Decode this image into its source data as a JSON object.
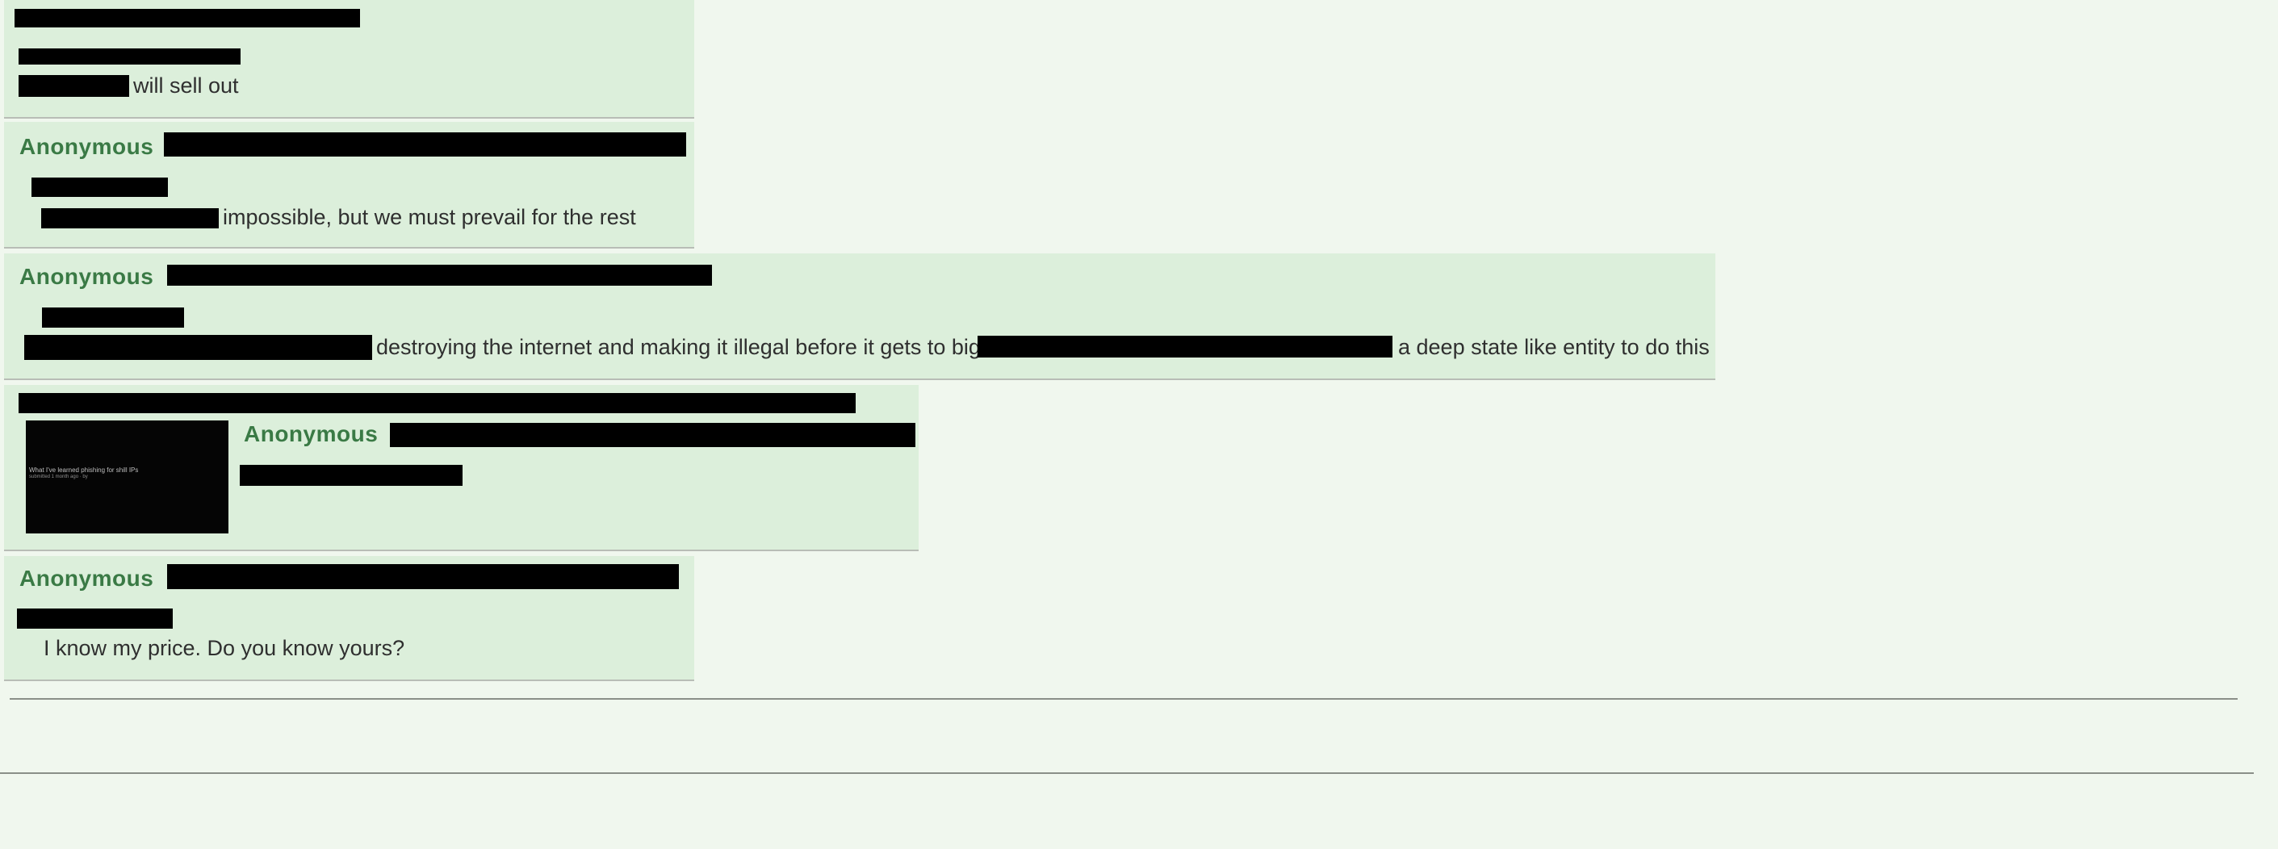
{
  "posts": [
    {
      "tail_text": "will sell out"
    },
    {
      "name": "Anonymous",
      "tail_text": "impossible, but we must prevail for the rest"
    },
    {
      "name": "Anonymous",
      "mid_text": "destroying the internet and making it illegal before it gets to big?",
      "tail_text": "a deep state like entity to do this"
    },
    {
      "name": "Anonymous",
      "thumb_caption": "What I've learned phishing for shill IPs",
      "thumb_sub": "submitted 1 month ago · by"
    },
    {
      "name": "Anonymous",
      "text": "I know my price. Do you know yours?"
    }
  ],
  "colors": {
    "page_bg": "#f0f7ee",
    "post_bg": "#dcefdb",
    "name_green": "#3a7a45",
    "redaction": "#000000"
  }
}
